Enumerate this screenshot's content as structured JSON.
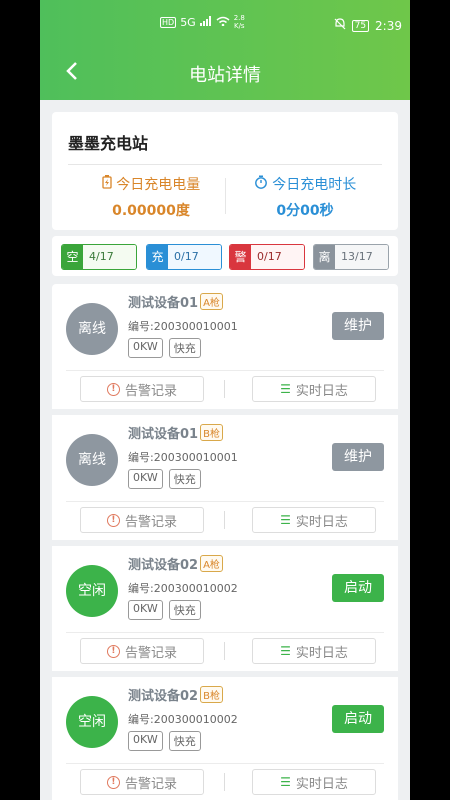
{
  "status_bar": {
    "hd": "HD",
    "net": "5G",
    "speed_top": "2.8",
    "speed_bottom": "K/s",
    "battery": "75",
    "time": "2:39"
  },
  "nav": {
    "back_icon": "chevron-left-icon",
    "title": "电站详情"
  },
  "station": {
    "name": "墨墨充电站",
    "energy_label": "今日充电电量",
    "energy_value": "0.00000度",
    "time_label": "今日充电时长",
    "time_value": "0分00秒"
  },
  "filters": [
    {
      "key": "空",
      "value": "4/17"
    },
    {
      "key": "充",
      "value": "0/17"
    },
    {
      "key": "警",
      "value": "0/17"
    },
    {
      "key": "离",
      "value": "13/17"
    }
  ],
  "devices": [
    {
      "status": "离线",
      "name": "测试设备01",
      "gun": "A枪",
      "code": "编号:200300010001",
      "power": "0KW",
      "mode": "快充",
      "action": "维护"
    },
    {
      "status": "离线",
      "name": "测试设备01",
      "gun": "B枪",
      "code": "编号:200300010001",
      "power": "0KW",
      "mode": "快充",
      "action": "维护"
    },
    {
      "status": "空闲",
      "name": "测试设备02",
      "gun": "A枪",
      "code": "编号:200300010002",
      "power": "0KW",
      "mode": "快充",
      "action": "启动"
    },
    {
      "status": "空闲",
      "name": "测试设备02",
      "gun": "B枪",
      "code": "编号:200300010002",
      "power": "0KW",
      "mode": "快充",
      "action": "启动"
    }
  ],
  "buttons": {
    "alarm": "告警记录",
    "log": "实时日志"
  },
  "colors": {
    "header_green": "#4fbf5b",
    "online_green": "#3cb34a",
    "offline_gray": "#8e97a0",
    "accent_orange": "#d9862a",
    "accent_blue": "#2a8fd6"
  }
}
